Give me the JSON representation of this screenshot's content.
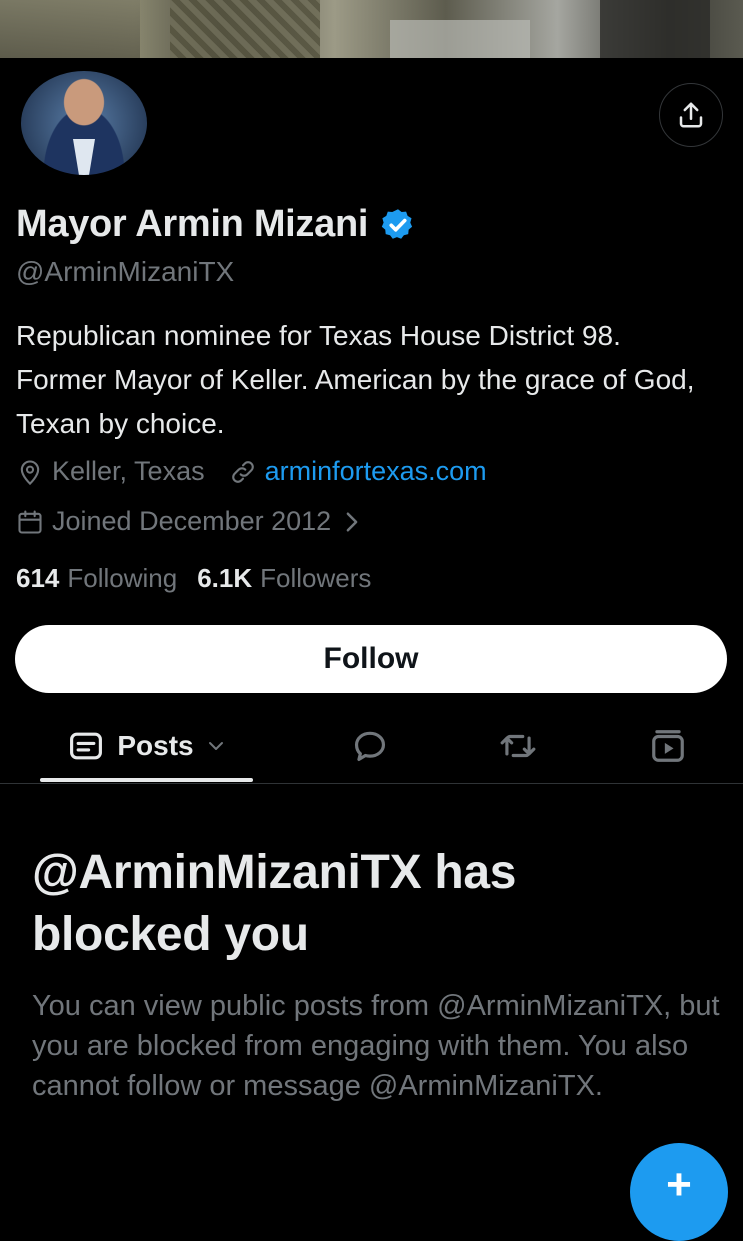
{
  "profile": {
    "name": "Mayor Armin Mizani",
    "handle": "@ArminMizaniTX",
    "bio": "Republican nominee for Texas House District 98. Former Mayor of Keller. American by the grace of God, Texan by choice.",
    "location": "Keller, Texas",
    "website": "arminfortexas.com",
    "joined": "Joined December 2012",
    "following_count": "614",
    "following_label": "Following",
    "followers_count": "6.1K",
    "followers_label": "Followers",
    "follow_button": "Follow",
    "verified": true
  },
  "tabs": {
    "posts_label": "Posts"
  },
  "blocked": {
    "title": "@ArminMizaniTX has blocked you",
    "message": "You can view public posts from @ArminMizaniTX, but you are blocked from engaging with them. You also cannot follow or message @ArminMizaniTX."
  },
  "fab": {
    "label": "+"
  },
  "colors": {
    "background": "#000000",
    "accent": "#1d9bf0",
    "text_primary": "#e7e9ea",
    "text_secondary": "#71767b"
  },
  "icons": {
    "share": "share-icon",
    "verified": "verified-badge-icon",
    "location": "location-pin-icon",
    "link": "link-icon",
    "calendar": "calendar-icon",
    "posts_tab": "posts-icon",
    "replies_tab": "reply-bubble-icon",
    "reposts_tab": "repost-icon",
    "media_tab": "media-icon"
  }
}
